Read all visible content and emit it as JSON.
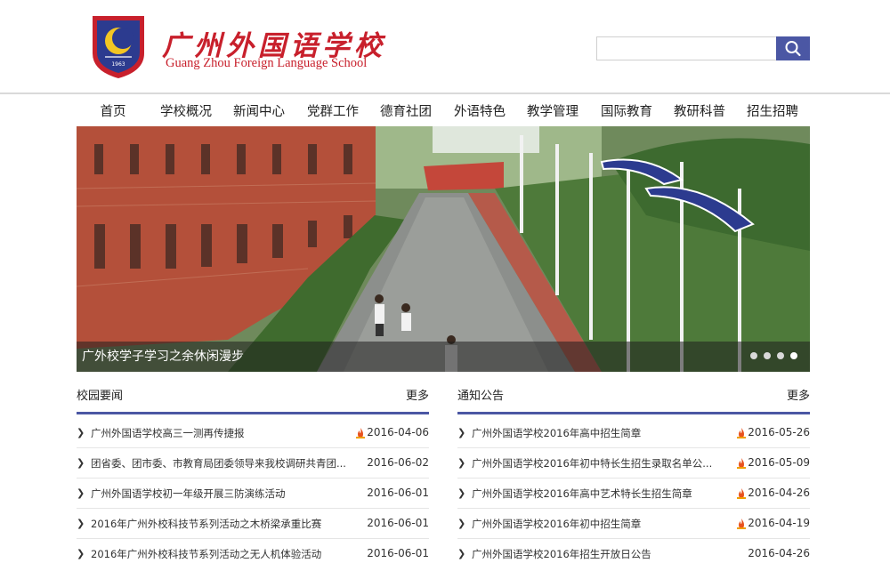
{
  "header": {
    "school_name_cn": "广州外国语学校",
    "school_name_en": "Guang Zhou Foreign Language School",
    "emblem_year": "1963",
    "search": {
      "placeholder": "",
      "value": ""
    },
    "accent_color": "#4b57a4",
    "brand_color": "#c8202c"
  },
  "nav": {
    "items": [
      {
        "label": "首页"
      },
      {
        "label": "学校概况"
      },
      {
        "label": "新闻中心"
      },
      {
        "label": "党群工作"
      },
      {
        "label": "德育社团"
      },
      {
        "label": "外语特色"
      },
      {
        "label": "教学管理"
      },
      {
        "label": "国际教育"
      },
      {
        "label": "教研科普"
      },
      {
        "label": "招生招聘"
      }
    ]
  },
  "banner": {
    "caption": "广外校学子学习之余休闲漫步",
    "slide_count": 4,
    "active_index": 3
  },
  "campus_news": {
    "title": "校园要闻",
    "more": "更多",
    "items": [
      {
        "title": "广州外国语学校高三一测再传捷报",
        "date": "2016-04-06",
        "hot": true
      },
      {
        "title": "团省委、团市委、市教育局团委领导来我校调研共青团...",
        "date": "2016-06-02",
        "hot": false
      },
      {
        "title": "广州外国语学校初一年级开展三防演练活动",
        "date": "2016-06-01",
        "hot": false
      },
      {
        "title": "2016年广州外校科技节系列活动之木桥梁承重比赛",
        "date": "2016-06-01",
        "hot": false
      },
      {
        "title": "2016年广州外校科技节系列活动之无人机体验活动",
        "date": "2016-06-01",
        "hot": false
      }
    ]
  },
  "notices": {
    "title": "通知公告",
    "more": "更多",
    "items": [
      {
        "title": "广州外国语学校2016年高中招生简章",
        "date": "2016-05-26",
        "hot": true
      },
      {
        "title": "广州外国语学校2016年初中特长生招生录取名单公...",
        "date": "2016-05-09",
        "hot": true
      },
      {
        "title": "广州外国语学校2016年高中艺术特长生招生简章",
        "date": "2016-04-26",
        "hot": true
      },
      {
        "title": "广州外国语学校2016年初中招生简章",
        "date": "2016-04-19",
        "hot": true
      },
      {
        "title": "广州外国语学校2016年招生开放日公告",
        "date": "2016-04-26",
        "hot": false
      }
    ]
  }
}
